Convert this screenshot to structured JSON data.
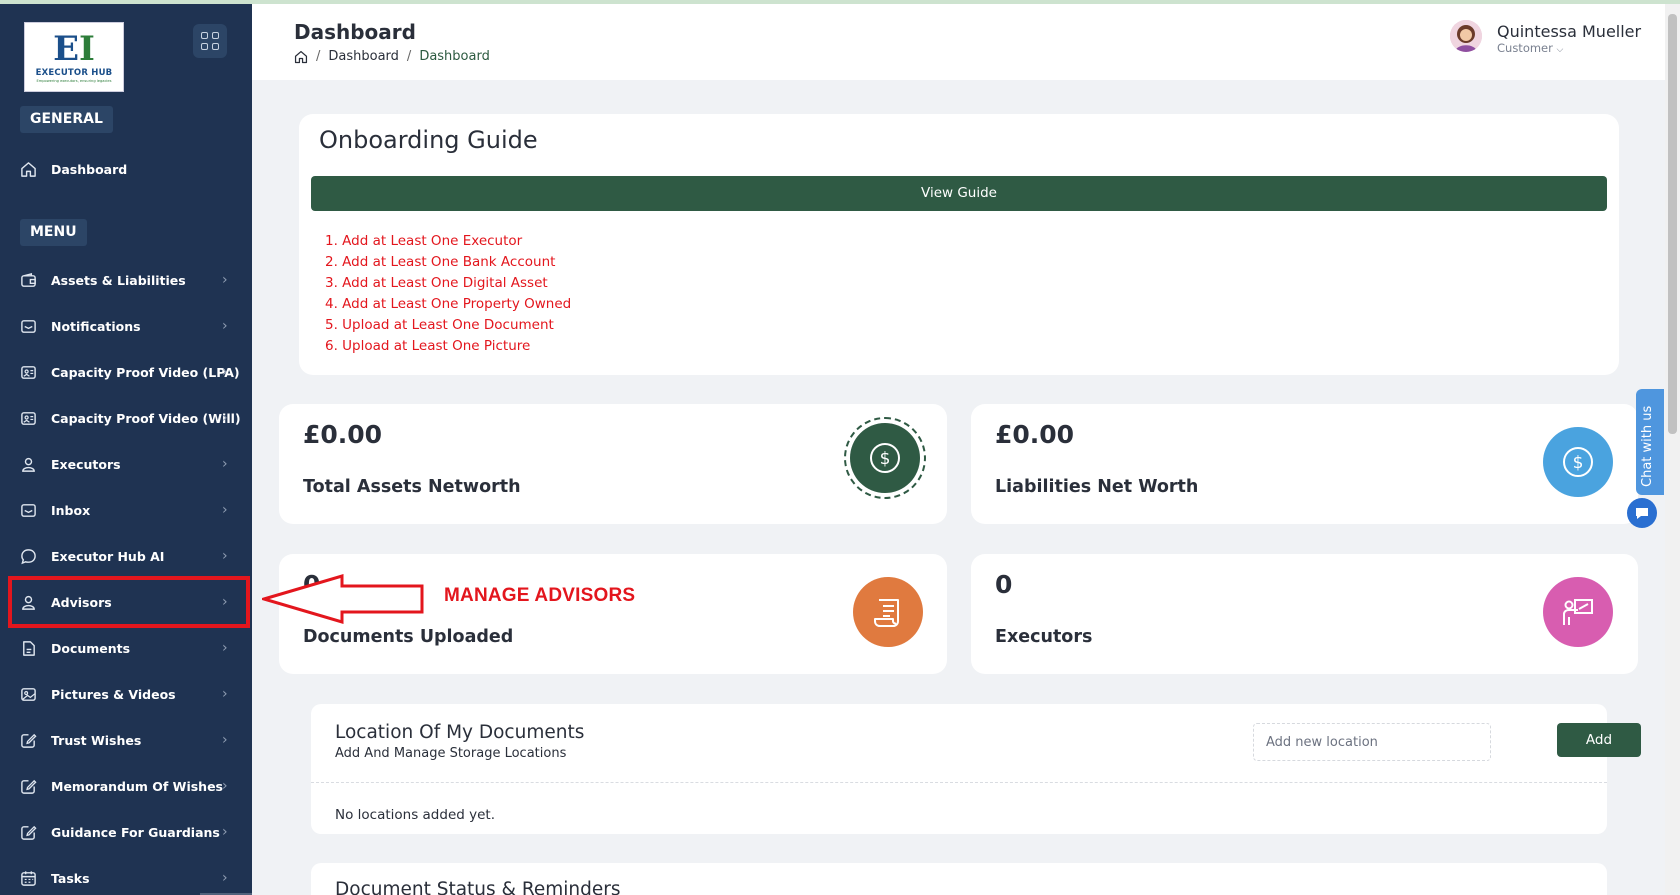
{
  "logo": {
    "mark": "EH",
    "name": "EXECUTOR HUB",
    "tagline": "Empowering executors, ensuring legacies"
  },
  "sidebar": {
    "general_label": "GENERAL",
    "menu_label": "MENU",
    "dashboard": {
      "label": "Dashboard",
      "icon": "home-icon"
    },
    "items": [
      {
        "label": "Assets & Liabilities",
        "icon": "wallet-icon"
      },
      {
        "label": "Notifications",
        "icon": "mail-icon"
      },
      {
        "label": "Capacity Proof Video (LPA)",
        "icon": "video-card-icon"
      },
      {
        "label": "Capacity Proof Video (Will)",
        "icon": "video-card-icon"
      },
      {
        "label": "Executors",
        "icon": "user-icon"
      },
      {
        "label": "Inbox",
        "icon": "mail-icon"
      },
      {
        "label": "Executor Hub AI",
        "icon": "chat-icon"
      },
      {
        "label": "Advisors",
        "icon": "user-icon"
      },
      {
        "label": "Documents",
        "icon": "document-icon"
      },
      {
        "label": "Pictures & Videos",
        "icon": "image-icon"
      },
      {
        "label": "Trust Wishes",
        "icon": "edit-icon"
      },
      {
        "label": "Memorandum Of Wishes",
        "icon": "edit-icon"
      },
      {
        "label": "Guidance For Guardians",
        "icon": "edit-icon"
      },
      {
        "label": "Tasks",
        "icon": "calendar-icon"
      }
    ]
  },
  "header": {
    "title": "Dashboard",
    "breadcrumb": [
      "Dashboard",
      "Dashboard"
    ],
    "user_name": "Quintessa Mueller",
    "user_role": "Customer"
  },
  "onboarding": {
    "title": "Onboarding Guide",
    "button": "View Guide",
    "steps": [
      "1. Add at Least One Executor",
      "2. Add at Least One Bank Account",
      "3. Add at Least One Digital Asset",
      "4. Add at Least One Property Owned",
      "5. Upload at Least One Document",
      "6. Upload at Least One Picture"
    ]
  },
  "stats": [
    {
      "value": "£0.00",
      "label": "Total Assets Networth",
      "color": "#2f5a44",
      "icon": "dollar-icon"
    },
    {
      "value": "£0.00",
      "label": "Liabilities Net Worth",
      "color": "#4aa3df",
      "icon": "dollar-icon"
    },
    {
      "value": "0",
      "label": "Documents Uploaded",
      "color": "#e07a3f",
      "icon": "receipt-icon"
    },
    {
      "value": "0",
      "label": "Executors",
      "color": "#d85db0",
      "icon": "presenter-icon"
    }
  ],
  "annotation": {
    "text": "MANAGE ADVISORS",
    "color": "#e3161d"
  },
  "locations": {
    "title": "Location Of My Documents",
    "subtitle": "Add And Manage Storage Locations",
    "input_placeholder": "Add new location",
    "add_button": "Add",
    "empty_text": "No locations added yet."
  },
  "document_status": {
    "title": "Document Status & Reminders"
  },
  "chat": {
    "label": "Chat with us"
  }
}
